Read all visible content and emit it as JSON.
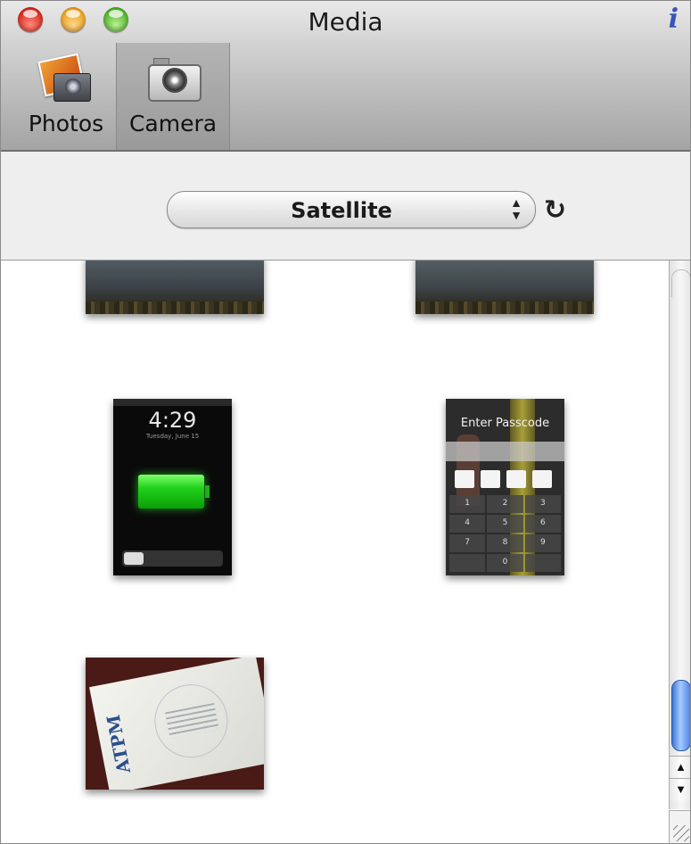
{
  "window": {
    "title": "Media",
    "info_label": "i"
  },
  "toolbar": {
    "items": [
      {
        "label": "Photos",
        "icon": "photos-icon"
      },
      {
        "label": "Camera",
        "icon": "camera-icon",
        "selected": true
      }
    ]
  },
  "source_popup": {
    "value": "Satellite",
    "arrows": "updown-icon"
  },
  "refresh": {
    "glyph": "↻",
    "icon": "refresh-icon"
  },
  "thumbnails": {
    "phone_lock": {
      "time": "4:29",
      "date": "Tuesday, June 15"
    },
    "phone_passcode": {
      "title": "Enter Passcode",
      "keys": [
        "1",
        "2",
        "3",
        "4",
        "5",
        "6",
        "7",
        "8",
        "9",
        "",
        "0",
        ""
      ]
    },
    "business_card": {
      "logo": "ATPM"
    }
  },
  "scrollbar": {
    "up_glyph": "▲",
    "down_glyph": "▼"
  }
}
